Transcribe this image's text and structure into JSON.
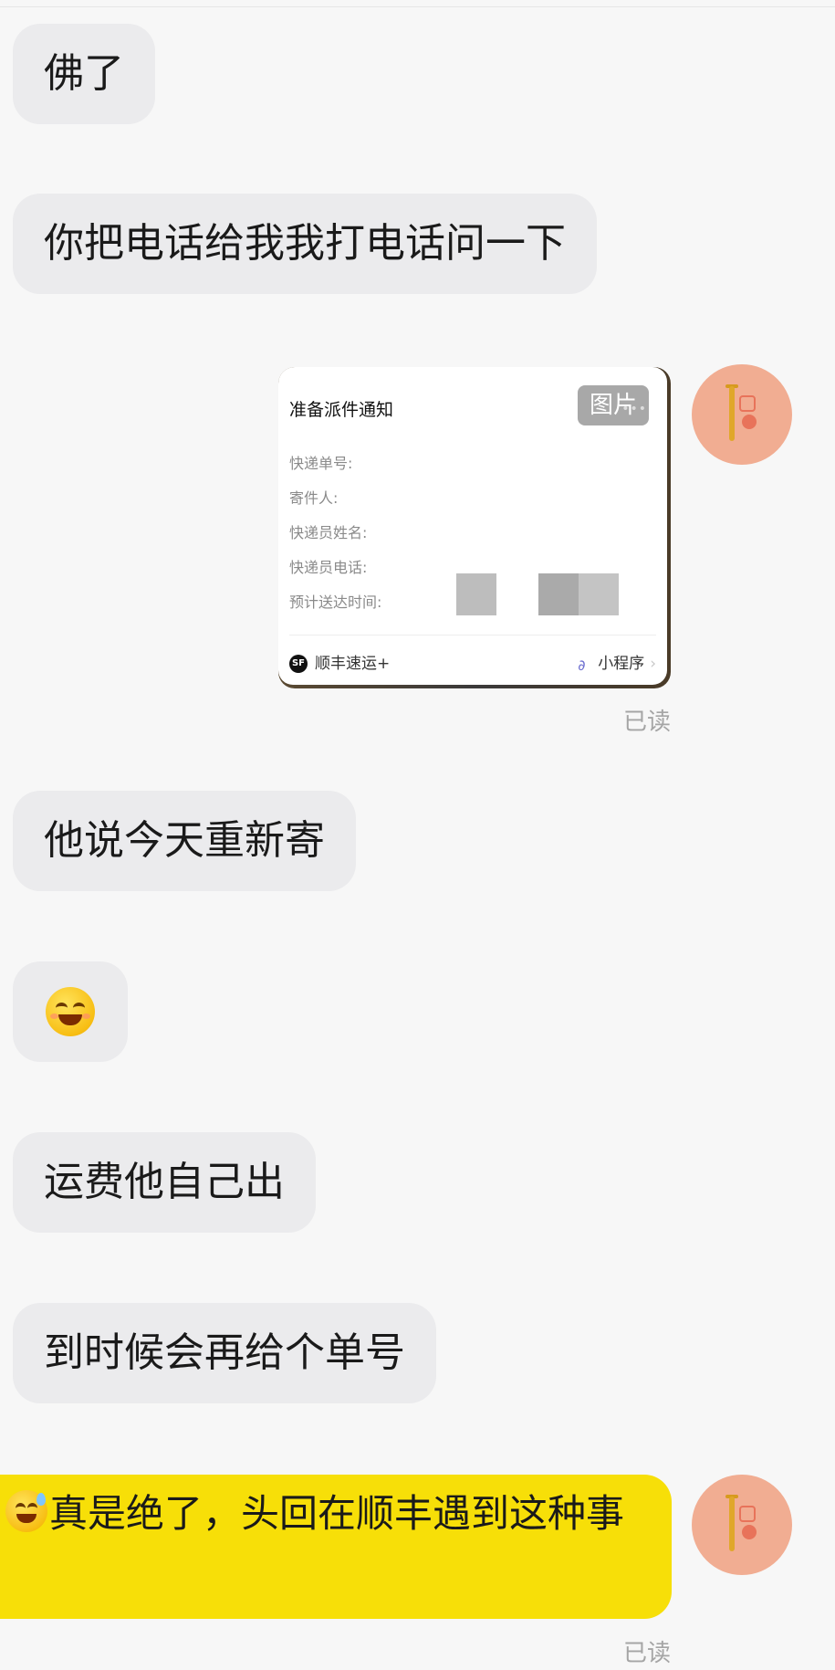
{
  "messages": {
    "m1": "佛了",
    "m2": "你把电话给我我打电话问一下",
    "m3": "他说今天重新寄",
    "m5": "运费他自己出",
    "m6": "到时候会再给个单号",
    "m7": "真是绝了，头回在顺丰遇到这种事"
  },
  "card": {
    "title": "准备派件通知",
    "tag": "图片",
    "fields": [
      "快递单号:",
      "寄件人:",
      "快递员姓名:",
      "快递员电话:",
      "预计送达时间:"
    ],
    "brand": "顺丰速运+",
    "mini_program": "小程序",
    "sf_logo": "SF"
  },
  "read_label": "已读",
  "icons": {
    "emoji_grin": "grinning-squinting-face-icon",
    "emoji_sweat": "grinning-face-with-sweat-icon",
    "avatar": "user-avatar"
  },
  "colors": {
    "background": "#f7f7f7",
    "incoming_bubble": "#ebebed",
    "outgoing_bubble": "#f7df08",
    "read_text": "#a5a5a5"
  }
}
